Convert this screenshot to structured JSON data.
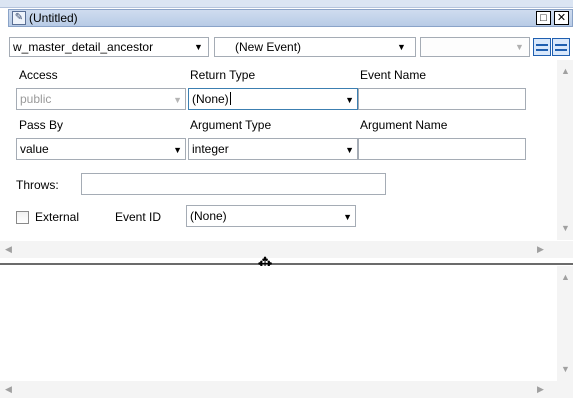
{
  "window": {
    "title": "(Untitled)",
    "maximize_glyph": "□",
    "close_glyph": "✕"
  },
  "selector": {
    "object": "w_master_detail_ancestor",
    "event": "(New Event)",
    "third": ""
  },
  "form": {
    "access_label": "Access",
    "access_value": "public",
    "return_type_label": "Return Type",
    "return_type_value": "(None)",
    "event_name_label": "Event Name",
    "event_name_value": "",
    "pass_by_label": "Pass By",
    "pass_by_value": "value",
    "argument_type_label": "Argument Type",
    "argument_type_value": "integer",
    "argument_name_label": "Argument Name",
    "argument_name_value": "",
    "throws_label": "Throws:",
    "throws_value": "",
    "external_label": "External",
    "event_id_label": "Event ID",
    "event_id_value": "(None)"
  },
  "icons": {
    "window": "script-window-icon",
    "dropdown": "chevron-down-icon",
    "scroll_up": "scroll-up-icon",
    "scroll_down": "scroll-down-icon",
    "scroll_left": "scroll-left-icon",
    "scroll_right": "scroll-right-icon",
    "splitter": "move-splitter-icon"
  },
  "colors": {
    "titlebar": "#b8cbe6",
    "field_border": "#a5acb5",
    "focus_border": "#3c7fb1",
    "splitter": "#6b6b6b",
    "layout_icon": "#1f5fb0"
  }
}
